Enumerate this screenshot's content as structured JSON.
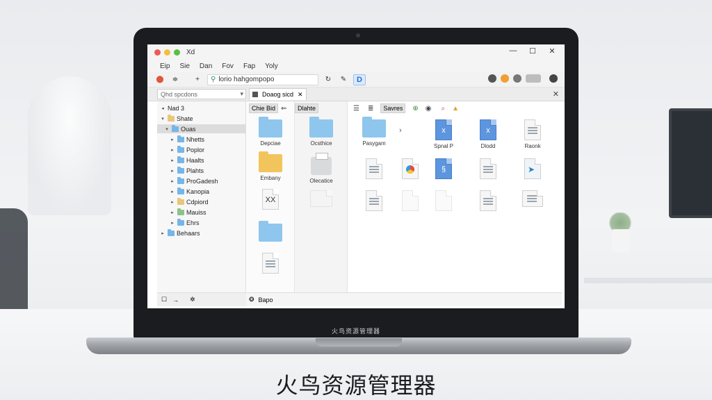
{
  "window": {
    "title": "Xd",
    "minimize": "—",
    "maximize": "☐",
    "close": "✕"
  },
  "menu": [
    "Eip",
    "Sie",
    "Dan",
    "Fov",
    "Fap",
    "Yoly"
  ],
  "toolbar": {
    "back": "⬤",
    "forward": "≑",
    "add": "+",
    "address": "lorio hahgompopo",
    "refresh": "↻",
    "edit": "✎",
    "quick": "D"
  },
  "tabs": {
    "search_placeholder": "Qhd spcdons",
    "search_dropdown": "▾",
    "active_tab": "Doaog sicd",
    "tab_close": "✕",
    "pane_close": "✕"
  },
  "sidebar": {
    "header": "Nad 3",
    "items": [
      {
        "label": "Shate",
        "caret": "▾",
        "color": "tan"
      },
      {
        "label": "Ouas",
        "caret": "▾",
        "color": "blue",
        "selected": true
      },
      {
        "label": "Nhetts",
        "caret": "▸",
        "color": "blue"
      },
      {
        "label": "Poplor",
        "caret": "▸",
        "color": "blue"
      },
      {
        "label": "Haalts",
        "caret": "▸",
        "color": "blue"
      },
      {
        "label": "Plahts",
        "caret": "▸",
        "color": "blue"
      },
      {
        "label": "ProGadesh",
        "caret": "▸",
        "color": "blue"
      },
      {
        "label": "Kanopia",
        "caret": "▸",
        "color": "blue"
      },
      {
        "label": "Cdpiord",
        "caret": "▸",
        "color": "tan"
      },
      {
        "label": "Mauiss",
        "caret": "▸",
        "color": "green"
      },
      {
        "label": "Ehrs",
        "caret": "▸",
        "color": "blue"
      },
      {
        "label": "Behaars",
        "caret": "▸",
        "color": "blue"
      }
    ]
  },
  "column_headers": {
    "col1_btn": "Chie Bid",
    "col1_icon": "⇐",
    "col2_btn": "Dlahte",
    "col3_icons": [
      "☰",
      "≣"
    ],
    "col3_btn": "Savres",
    "col3_tools": [
      "⊕",
      "◉",
      "⌕",
      "▲"
    ]
  },
  "col1_files": [
    {
      "label": "Depciae",
      "kind": "folder"
    },
    {
      "label": "Embany",
      "kind": "folder-yellow"
    },
    {
      "label": "",
      "kind": "doc-x",
      "glyph": "XX"
    },
    {
      "label": "",
      "kind": "folder"
    },
    {
      "label": "",
      "kind": "doc"
    }
  ],
  "col2_files": [
    {
      "label": "Ocsthice",
      "kind": "folder"
    },
    {
      "label": "Olecatice",
      "kind": "printer"
    },
    {
      "label": "",
      "kind": "doc-faded"
    }
  ],
  "col3_files": [
    {
      "label": "Pasygam",
      "kind": "folder"
    },
    {
      "label": "Spnal P",
      "kind": "doc-blue",
      "glyph": "x"
    },
    {
      "label": "Dlodd",
      "kind": "doc-blue",
      "glyph": "x"
    },
    {
      "label": "Raonk",
      "kind": "doc"
    },
    {
      "label": "",
      "kind": "doc"
    },
    {
      "label": "",
      "kind": "doc-color"
    },
    {
      "label": "",
      "kind": "doc-blue",
      "glyph": "§"
    },
    {
      "label": "",
      "kind": "doc"
    },
    {
      "label": "",
      "kind": "doc-arrow"
    },
    {
      "label": "",
      "kind": "doc"
    },
    {
      "label": "",
      "kind": "doc-faded"
    },
    {
      "label": "",
      "kind": "doc-faded"
    },
    {
      "label": "",
      "kind": "doc"
    },
    {
      "label": "",
      "kind": "doc-book"
    }
  ],
  "col3_arrow": "›",
  "status_left": {
    "icon1": "☐",
    "icon2": "→",
    "icon3": "✲"
  },
  "status_right": {
    "icon": "❂",
    "text": "Bapo"
  },
  "laptop_brand": "火鸟资源管理器",
  "caption": "火鸟资源管理器"
}
